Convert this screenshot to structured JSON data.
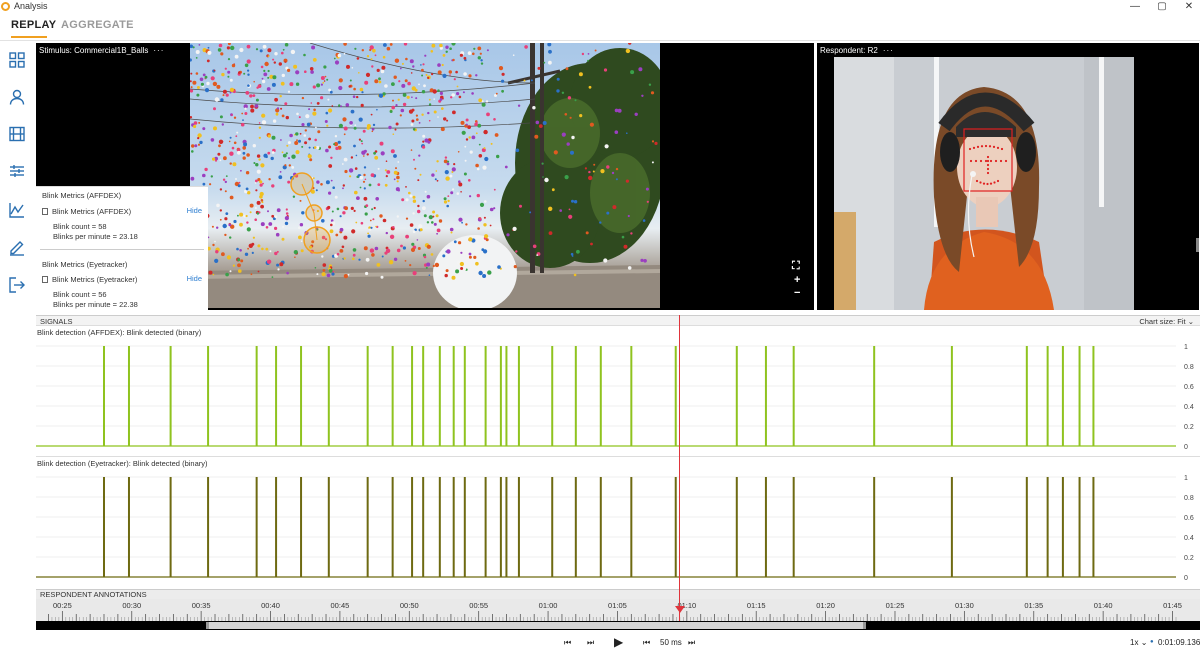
{
  "app": {
    "title": "Analysis",
    "window_controls": {
      "minimize": "—",
      "maximize": "▢",
      "close": "✕"
    }
  },
  "tabs": [
    {
      "label": "REPLAY",
      "active": true
    },
    {
      "label": "AGGREGATE",
      "active": false
    }
  ],
  "sidebar": {
    "items": [
      {
        "name": "dashboard-icon"
      },
      {
        "name": "respondent-icon"
      },
      {
        "name": "film-icon"
      },
      {
        "name": "sliders-icon"
      },
      {
        "name": "chart-icon"
      },
      {
        "name": "edit-icon"
      },
      {
        "name": "exit-icon"
      }
    ]
  },
  "stimulus_pane": {
    "label": "Stimulus: Commercial1B_Balls",
    "menu": "···",
    "zoom": {
      "fullscreen": "⛶",
      "plus": "+",
      "minus": "−"
    }
  },
  "respondent_pane": {
    "label": "Respondent: R2",
    "menu": "···"
  },
  "metrics": {
    "affdex": {
      "header": "Blink Metrics (AFFDEX)",
      "item": "Blink Metrics (AFFDEX)",
      "hide": "Hide",
      "count": "Blink count = 58",
      "rate": "Blinks per minute = 23.18"
    },
    "eyetracker": {
      "header": "Blink Metrics (Eyetracker)",
      "item": "Blink Metrics (Eyetracker)",
      "hide": "Hide",
      "count": "Blink count = 56",
      "rate": "Blinks per minute = 22.38"
    }
  },
  "signals": {
    "title": "SIGNALS",
    "chart_size_label": "Chart size:",
    "chart_size_value": "Fit",
    "chart_size_caret": "⌄"
  },
  "chart_data": [
    {
      "type": "line",
      "title": "Blink detection (AFFDEX): Blink detected (binary)",
      "color": "#8fc31f",
      "ylim": [
        0,
        1
      ],
      "yticks": [
        "1",
        "0.8",
        "0.6",
        "0.4",
        "0.2",
        "0"
      ],
      "xlim": [
        23.1,
        105.25
      ],
      "pulses_at_x": [
        28.0,
        29.8,
        32.8,
        35.5,
        39.0,
        40.4,
        42.2,
        44.2,
        47.0,
        48.8,
        50.2,
        51.0,
        52.2,
        53.2,
        54.0,
        55.5,
        56.6,
        57.0,
        57.9,
        60.3,
        62.0,
        63.8,
        66.0,
        69.2,
        73.6,
        75.7,
        77.7,
        83.5,
        89.1,
        94.5,
        96.0,
        97.1,
        98.3,
        99.3
      ]
    },
    {
      "type": "line",
      "title": "Blink detection (Eyetracker): Blink detected (binary)",
      "color": "#6e6a12",
      "ylim": [
        0,
        1
      ],
      "yticks": [
        "1",
        "0.8",
        "0.6",
        "0.4",
        "0.2",
        "0"
      ],
      "xlim": [
        23.1,
        105.25
      ],
      "pulses_at_x": [
        28.0,
        29.8,
        32.8,
        35.5,
        39.0,
        40.4,
        42.2,
        44.2,
        47.0,
        48.8,
        50.2,
        51.0,
        52.2,
        53.2,
        54.0,
        55.5,
        56.6,
        57.0,
        57.9,
        60.3,
        62.0,
        63.8,
        66.0,
        69.2,
        73.6,
        75.7,
        77.7,
        83.5,
        89.1,
        94.5,
        96.0,
        97.1,
        98.3,
        99.3
      ]
    }
  ],
  "annotations": {
    "title": "RESPONDENT ANNOTATIONS"
  },
  "timeline": {
    "ticks": [
      {
        "label": "00:25",
        "t": 25
      },
      {
        "label": "00:30",
        "t": 30
      },
      {
        "label": "00:35",
        "t": 35
      },
      {
        "label": "00:40",
        "t": 40
      },
      {
        "label": "00:45",
        "t": 45
      },
      {
        "label": "00:50",
        "t": 50
      },
      {
        "label": "00:55",
        "t": 55
      },
      {
        "label": "01:00",
        "t": 60
      },
      {
        "label": "01:05",
        "t": 65
      },
      {
        "label": "01:10",
        "t": 70
      },
      {
        "label": "01:15",
        "t": 75
      },
      {
        "label": "01:20",
        "t": 80
      },
      {
        "label": "01:25",
        "t": 85
      },
      {
        "label": "01:30",
        "t": 90
      },
      {
        "label": "01:35",
        "t": 95
      },
      {
        "label": "01:40",
        "t": 100
      },
      {
        "label": "01:45",
        "t": 105
      }
    ],
    "playhead_t": 69.14
  },
  "playback": {
    "prev_start": "⏮",
    "prev": "⏭",
    "play": "▶",
    "step_back": "⏮",
    "step_value": "50 ms",
    "step_fwd": "⏭",
    "speed": "1x",
    "speed_caret": "⌄",
    "time": "0:01:09.136",
    "clock_icon": "●"
  },
  "colors": {
    "accent": "#f0a020",
    "playhead": "#e0343b",
    "link": "#2f7fd1"
  }
}
